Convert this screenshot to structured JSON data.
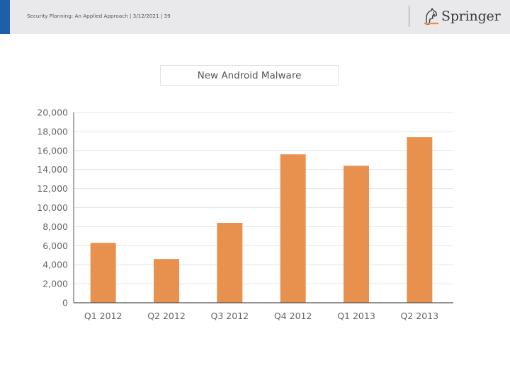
{
  "header": {
    "footer_text": "Security Planning: An Applied Approach | 3/12/2021 | 39",
    "logo_text": "Springer",
    "logo_icon": "springer-horse-icon"
  },
  "colors": {
    "accent": "#1f5fa8",
    "bar": "#e8914f",
    "grid": "#e6e6e6",
    "axis": "#555555",
    "tick_text": "#666666"
  },
  "chart_data": {
    "type": "bar",
    "title": "New Android Malware",
    "categories": [
      "Q1 2012",
      "Q2 2012",
      "Q3 2012",
      "Q4 2012",
      "Q1 2013",
      "Q2 2013"
    ],
    "values": [
      6300,
      4600,
      8400,
      15600,
      14400,
      17400
    ],
    "ylim": [
      0,
      20000
    ],
    "yticks": [
      0,
      2000,
      4000,
      6000,
      8000,
      10000,
      12000,
      14000,
      16000,
      18000,
      20000
    ],
    "ytick_labels": [
      "0",
      "2,000",
      "4,000",
      "6,000",
      "8,000",
      "10,000",
      "12,000",
      "14,000",
      "16,000",
      "18,000",
      "20,000"
    ],
    "xlabel": "",
    "ylabel": "",
    "grid": true,
    "legend": "none"
  }
}
